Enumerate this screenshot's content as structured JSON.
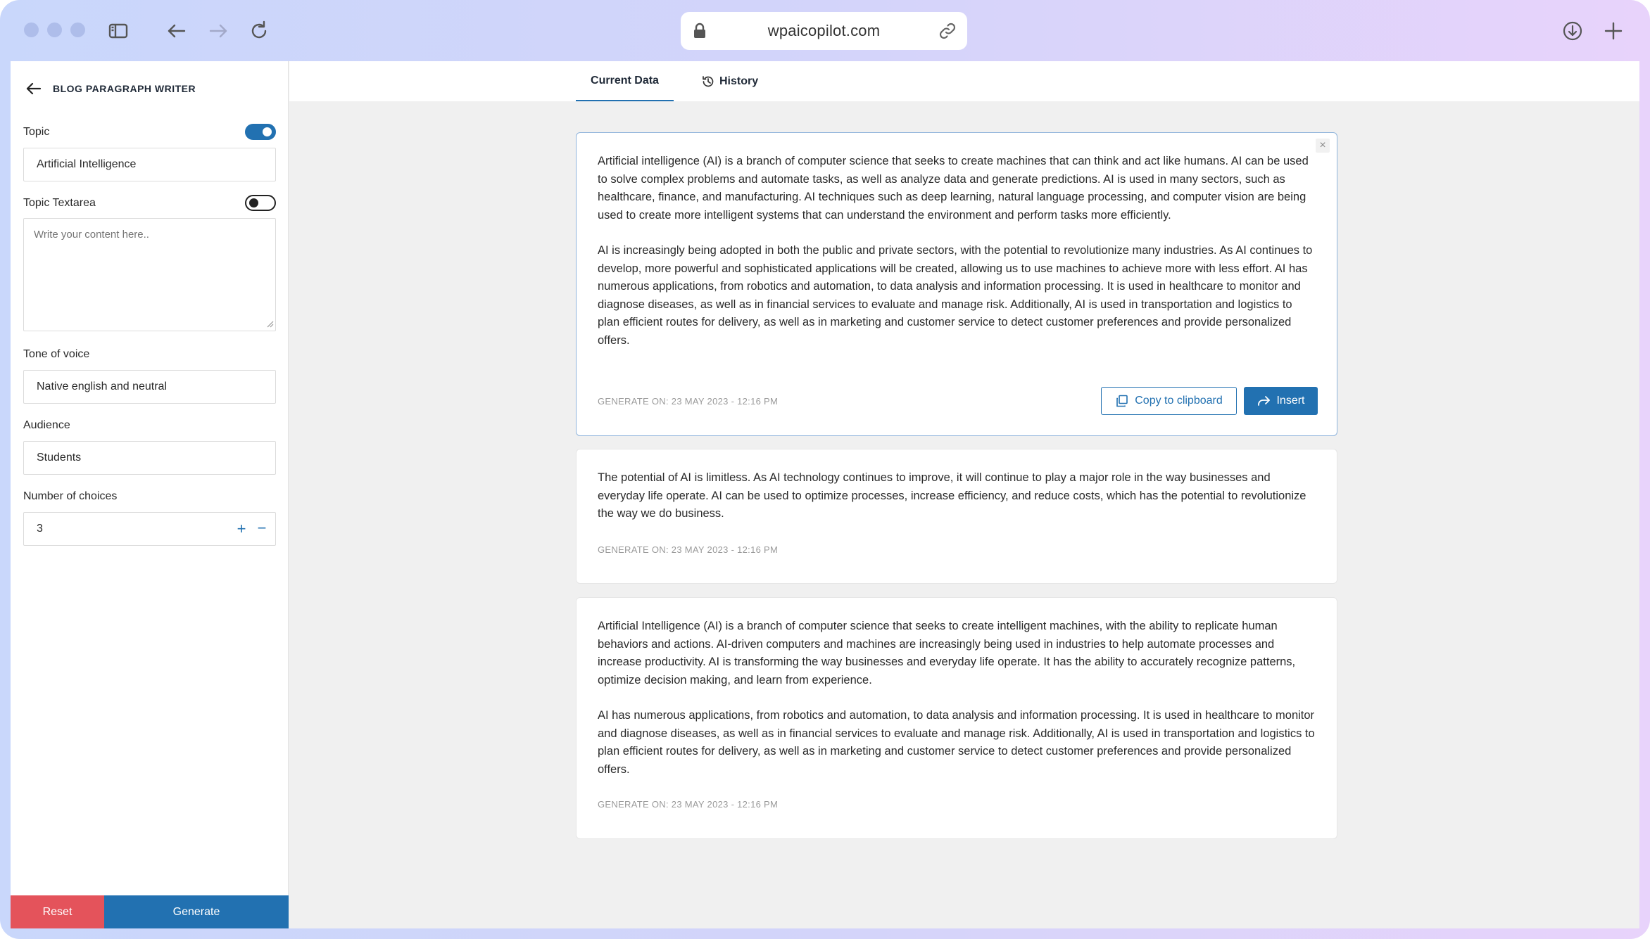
{
  "browser": {
    "url": "wpaicopilot.com"
  },
  "sidebar": {
    "title": "BLOG PARAGRAPH WRITER",
    "topic": {
      "label": "Topic",
      "value": "Artificial Intelligence",
      "toggle_on": true
    },
    "topic_textarea": {
      "label": "Topic Textarea",
      "placeholder": "Write your content here..",
      "toggle_on": false
    },
    "tone": {
      "label": "Tone of voice",
      "value": "Native english and neutral"
    },
    "audience": {
      "label": "Audience",
      "value": "Students"
    },
    "choices": {
      "label": "Number of choices",
      "value": "3",
      "plus": "+",
      "minus": "−"
    },
    "reset_label": "Reset",
    "generate_label": "Generate"
  },
  "tabs": [
    {
      "label": "Current Data",
      "active": true
    },
    {
      "label": "History",
      "active": false
    }
  ],
  "results": [
    {
      "paragraphs": [
        "Artificial intelligence (AI) is a branch of computer science that seeks to create machines that can think and act like humans. AI can be used to solve complex problems and automate tasks, as well as analyze data and generate predictions. AI is used in many sectors, such as healthcare, finance, and manufacturing. AI techniques such as deep learning, natural language processing, and computer vision are being used to create more intelligent systems that can understand the environment and perform tasks more efficiently.",
        "AI is increasingly being adopted in both the public and private sectors, with the potential to revolutionize many industries. As AI continues to develop, more powerful and sophisticated applications will be created, allowing us to use machines to achieve more with less effort. AI has numerous applications, from robotics and automation, to data analysis and information processing. It is used in healthcare to monitor and diagnose diseases, as well as in financial services to evaluate and manage risk. Additionally, AI is used in transportation and logistics to plan efficient routes for delivery, as well as in marketing and customer service to detect customer preferences and provide personalized offers."
      ],
      "generated_on": "GENERATE ON: 23 MAY 2023 - 12:16 PM",
      "copy_label": "Copy to clipboard",
      "insert_label": "Insert",
      "close_label": "×"
    },
    {
      "paragraphs": [
        "The potential of AI is limitless. As AI technology continues to improve, it will continue to play a major role in the way businesses and everyday life operate. AI can be used to optimize processes, increase efficiency, and reduce costs, which has the potential to revolutionize the way we do business."
      ],
      "generated_on": "GENERATE ON: 23 MAY 2023 - 12:16 PM"
    },
    {
      "paragraphs": [
        "Artificial Intelligence (AI) is a branch of computer science that seeks to create intelligent machines, with the ability to replicate human behaviors and actions. AI-driven computers and machines are increasingly being used in industries to help automate processes and increase productivity. AI is transforming the way businesses and everyday life operate. It has the ability to accurately recognize patterns, optimize decision making, and learn from experience.",
        "AI has numerous applications, from robotics and automation, to data analysis and information processing. It is used in healthcare to monitor and diagnose diseases, as well as in financial services to evaluate and manage risk. Additionally, AI is used in transportation and logistics to plan efficient routes for delivery, as well as in marketing and customer service to detect customer preferences and provide personalized offers."
      ],
      "generated_on": "GENERATE ON: 23 MAY 2023 - 12:16 PM"
    }
  ],
  "colors": {
    "accent": "#2271b1",
    "reset": "#e4535b",
    "window_gradient_start": "#c9d7fb",
    "window_gradient_end": "#e8d3fb"
  },
  "icons": {
    "sidebar_toggle": "sidebar-icon",
    "back": "arrow-left-icon",
    "forward": "arrow-right-icon",
    "reload": "reload-icon",
    "lock": "lock-icon",
    "link": "link-icon",
    "download": "download-icon",
    "new_tab": "plus-icon",
    "history": "history-icon",
    "copy": "copy-icon",
    "insert": "share-arrow-icon"
  }
}
